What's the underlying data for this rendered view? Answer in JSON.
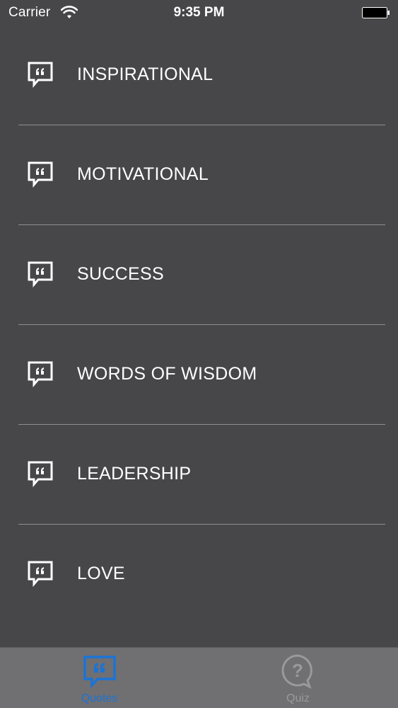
{
  "status_bar": {
    "carrier": "Carrier",
    "time": "9:35 PM"
  },
  "categories": [
    {
      "label": "INSPIRATIONAL",
      "icon": "quote-bubble-icon"
    },
    {
      "label": "MOTIVATIONAL",
      "icon": "quote-bubble-icon"
    },
    {
      "label": "SUCCESS",
      "icon": "quote-bubble-icon"
    },
    {
      "label": "WORDS OF WISDOM",
      "icon": "quote-bubble-icon"
    },
    {
      "label": "LEADERSHIP",
      "icon": "quote-bubble-icon"
    },
    {
      "label": "LOVE",
      "icon": "quote-bubble-icon"
    }
  ],
  "tab_bar": {
    "tabs": [
      {
        "label": "Quotes",
        "icon": "quote-bubble-icon",
        "selected": true
      },
      {
        "label": "Quiz",
        "icon": "question-bubble-icon",
        "selected": false
      }
    ]
  },
  "colors": {
    "background": "#474649",
    "text": "#ffffff",
    "separator": "#8e8d90",
    "tab_bar": "#706f72",
    "tab_active": "#1a74d6",
    "tab_inactive": "#9a999c"
  }
}
